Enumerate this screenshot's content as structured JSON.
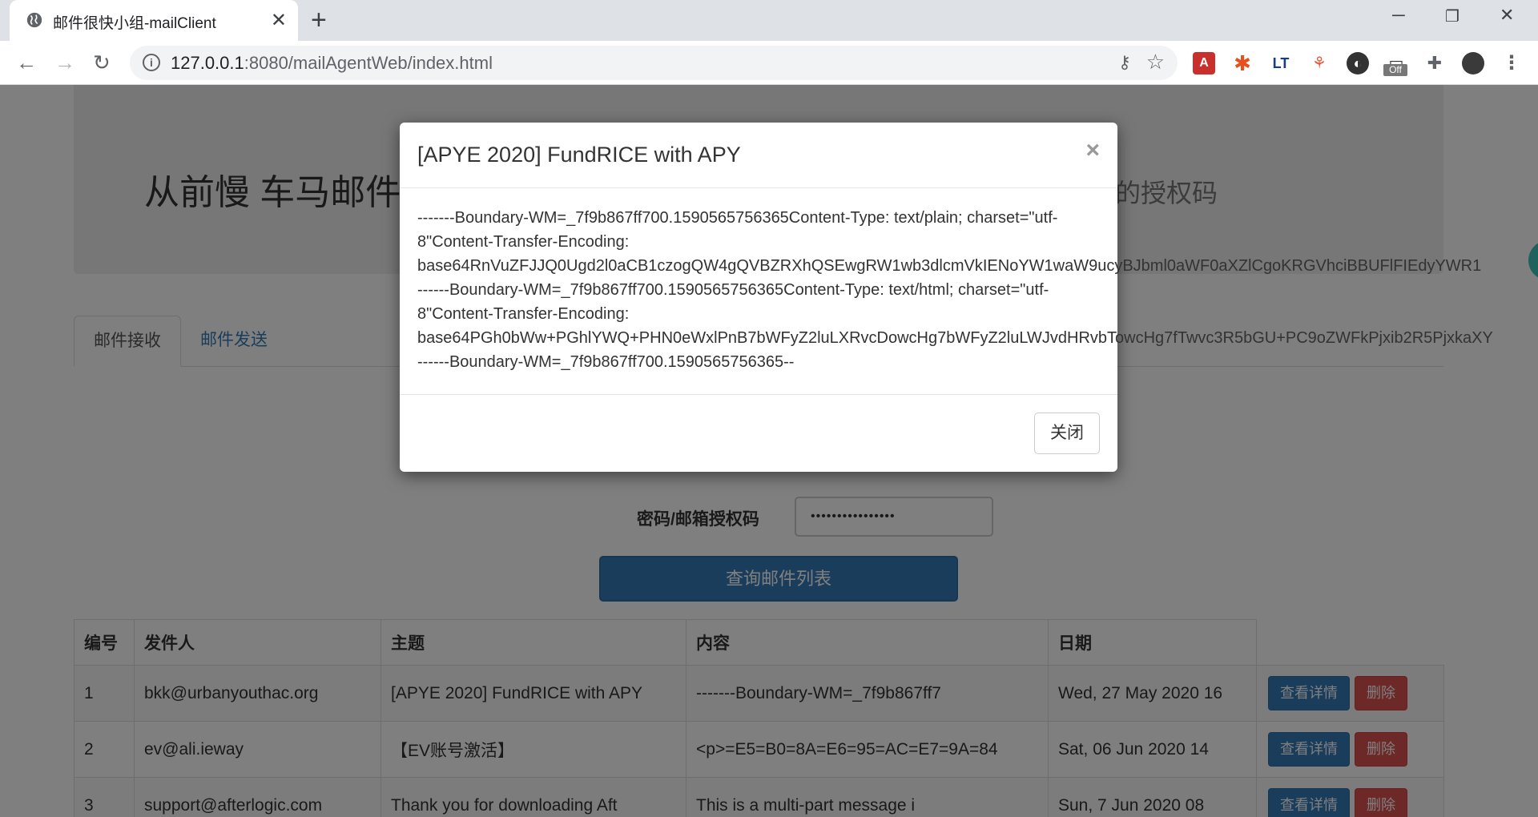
{
  "browser": {
    "tab_title": "邮件很快小组-mailClient",
    "url_host": "127.0.0.1",
    "url_rest": ":8080/mailAgentWeb/index.html",
    "ext_off_badge": "Off"
  },
  "header": {
    "title": "从前慢 车马邮件",
    "subtitle": "的授权码"
  },
  "tabs": [
    {
      "label": "邮件接收"
    },
    {
      "label": "邮件发送"
    }
  ],
  "form": {
    "password_label": "密码/邮箱授权码",
    "password_value": "••••••••••••••••",
    "query_button": "查询邮件列表"
  },
  "table": {
    "headers": [
      "编号",
      "发件人",
      "主题",
      "内容",
      "日期"
    ],
    "rows": [
      {
        "id": "1",
        "sender": "bkk@urbanyouthac.org",
        "subject": "[APYE 2020] FundRICE with APY",
        "content": "-------Boundary-WM=_7f9b867ff7",
        "date": "Wed, 27 May 2020 16"
      },
      {
        "id": "2",
        "sender": "ev@ali.ieway",
        "subject": "【EV账号激活】",
        "content": "<p>=E5=B0=8A=E6=95=AC=E7=9A=84",
        "date": "Sat, 06 Jun 2020 14"
      },
      {
        "id": "3",
        "sender": "support@afterlogic.com",
        "subject": "Thank you for downloading Aft",
        "content": "This is a multi-part message i",
        "date": "Sun, 7 Jun 2020 08"
      }
    ],
    "detail_button": "查看详情",
    "delete_button": "删除"
  },
  "modal": {
    "title": "[APYE 2020] FundRICE with APY",
    "body_lines": [
      "-------Boundary-WM=_7f9b867ff700.1590565756365Content-Type: text/plain; charset=\"utf-",
      "8\"Content-Transfer-Encoding:",
      "base64RnVuZFJJQ0Ugd2l0aCB1czogQW4gQVBZRXhQSEwgRW1wb3dlcmVkIENoYW1waW9ucyBJbml0aWF0aXZlCgoKRGVhciBBUFlFIEdyYWR1",
      "------Boundary-WM=_7f9b867ff700.1590565756365Content-Type: text/html; charset=\"utf-",
      "8\"Content-Transfer-Encoding:",
      "base64PGh0bWw+PGhlYWQ+PHN0eWxlPnB7bWFyZ2luLXRvcDowcHg7bWFyZ2luLWJvdHRvbTowcHg7fTwvc3R5bGU+PC9oZWFkPjxib2R5PjxkaXY",
      "------Boundary-WM=_7f9b867ff700.1590565756365--"
    ],
    "close_button": "关闭"
  }
}
